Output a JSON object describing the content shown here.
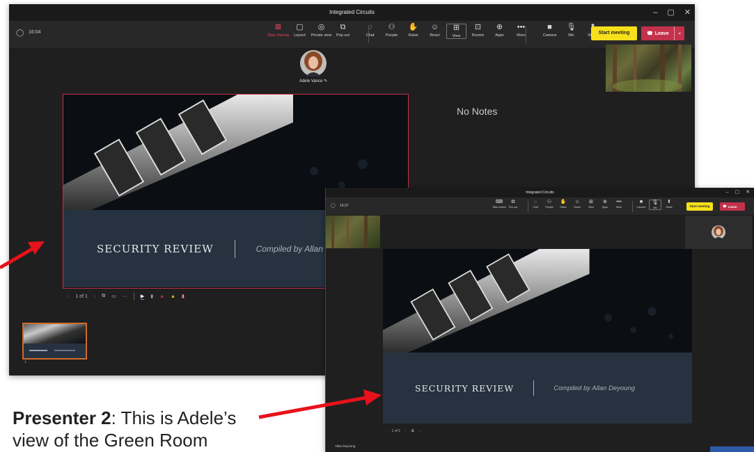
{
  "window1": {
    "title": "Integrated Circuits",
    "time": "16:04",
    "toolbar": [
      {
        "icon": "stop-share-icon",
        "label": "Stop sharing",
        "glyph": "⊠",
        "red": true
      },
      {
        "icon": "layout-icon",
        "label": "Layout",
        "glyph": "▢"
      },
      {
        "icon": "private-view-icon",
        "label": "Private view",
        "glyph": "◎"
      },
      {
        "icon": "pop-out-icon",
        "label": "Pop out",
        "glyph": "⧉"
      },
      {
        "icon": "chat-icon",
        "label": "Chat",
        "glyph": "◌"
      },
      {
        "icon": "people-icon",
        "label": "People",
        "glyph": "⚇"
      },
      {
        "icon": "raise-hand-icon",
        "label": "Raise",
        "glyph": "✋"
      },
      {
        "icon": "react-icon",
        "label": "React",
        "glyph": "☺"
      },
      {
        "icon": "view-icon",
        "label": "View",
        "glyph": "⊞"
      },
      {
        "icon": "rooms-icon",
        "label": "Rooms",
        "glyph": "⊡"
      },
      {
        "icon": "apps-icon",
        "label": "Apps",
        "glyph": "⊕"
      },
      {
        "icon": "more-icon",
        "label": "More",
        "glyph": "•••"
      },
      {
        "icon": "camera-icon",
        "label": "Camera",
        "glyph": "■"
      },
      {
        "icon": "mic-icon",
        "label": "Mic",
        "glyph": "🎙"
      },
      {
        "icon": "share-icon",
        "label": "Share",
        "glyph": "⬆"
      }
    ],
    "start_meeting": "Start meeting",
    "leave": "Leave",
    "participant_name": "Adele Vance",
    "notes": "No Notes",
    "slide_title": "SECURITY REVIEW",
    "slide_subtitle": "Compiled by Allan",
    "page_indicator": "1 of 1",
    "thumb_number": "1"
  },
  "window2": {
    "title": "Integrated Circuits",
    "time": "16:37",
    "toolbar": [
      {
        "icon": "take-control-icon",
        "label": "Take control",
        "glyph": "⌨"
      },
      {
        "icon": "pop-out-icon",
        "label": "Pop out",
        "glyph": "⧉"
      },
      {
        "icon": "chat-icon",
        "label": "Chat",
        "glyph": "◌"
      },
      {
        "icon": "people-icon",
        "label": "People",
        "glyph": "⚇"
      },
      {
        "icon": "raise-hand-icon",
        "label": "Raise",
        "glyph": "✋"
      },
      {
        "icon": "react-icon",
        "label": "React",
        "glyph": "☺"
      },
      {
        "icon": "view-icon",
        "label": "View",
        "glyph": "⊞"
      },
      {
        "icon": "apps-icon",
        "label": "Apps",
        "glyph": "⊕"
      },
      {
        "icon": "more-icon",
        "label": "More",
        "glyph": "•••"
      },
      {
        "icon": "camera-icon",
        "label": "Camera",
        "glyph": "■"
      },
      {
        "icon": "mic-icon",
        "label": "Mic",
        "glyph": "🎙"
      },
      {
        "icon": "share-icon",
        "label": "Share",
        "glyph": "⬆"
      }
    ],
    "start_meeting": "Start meeting",
    "leave": "Leave",
    "presenter_name": "Allan Deyoung",
    "slide_title": "SECURITY REVIEW",
    "slide_subtitle": "Compiled by Allan Deyoung",
    "page_indicator": "1 of 1"
  },
  "callout": {
    "bold": "Presenter 2",
    "text": ": This is Adele’s",
    "line2": "view of the Green Room"
  },
  "colors": {
    "accent_red": "#c4314b",
    "start_yellow": "#f7e01b",
    "arrow_red": "#e8121b",
    "slide_band": "#26323f",
    "thumb_border": "#d36a2a"
  }
}
